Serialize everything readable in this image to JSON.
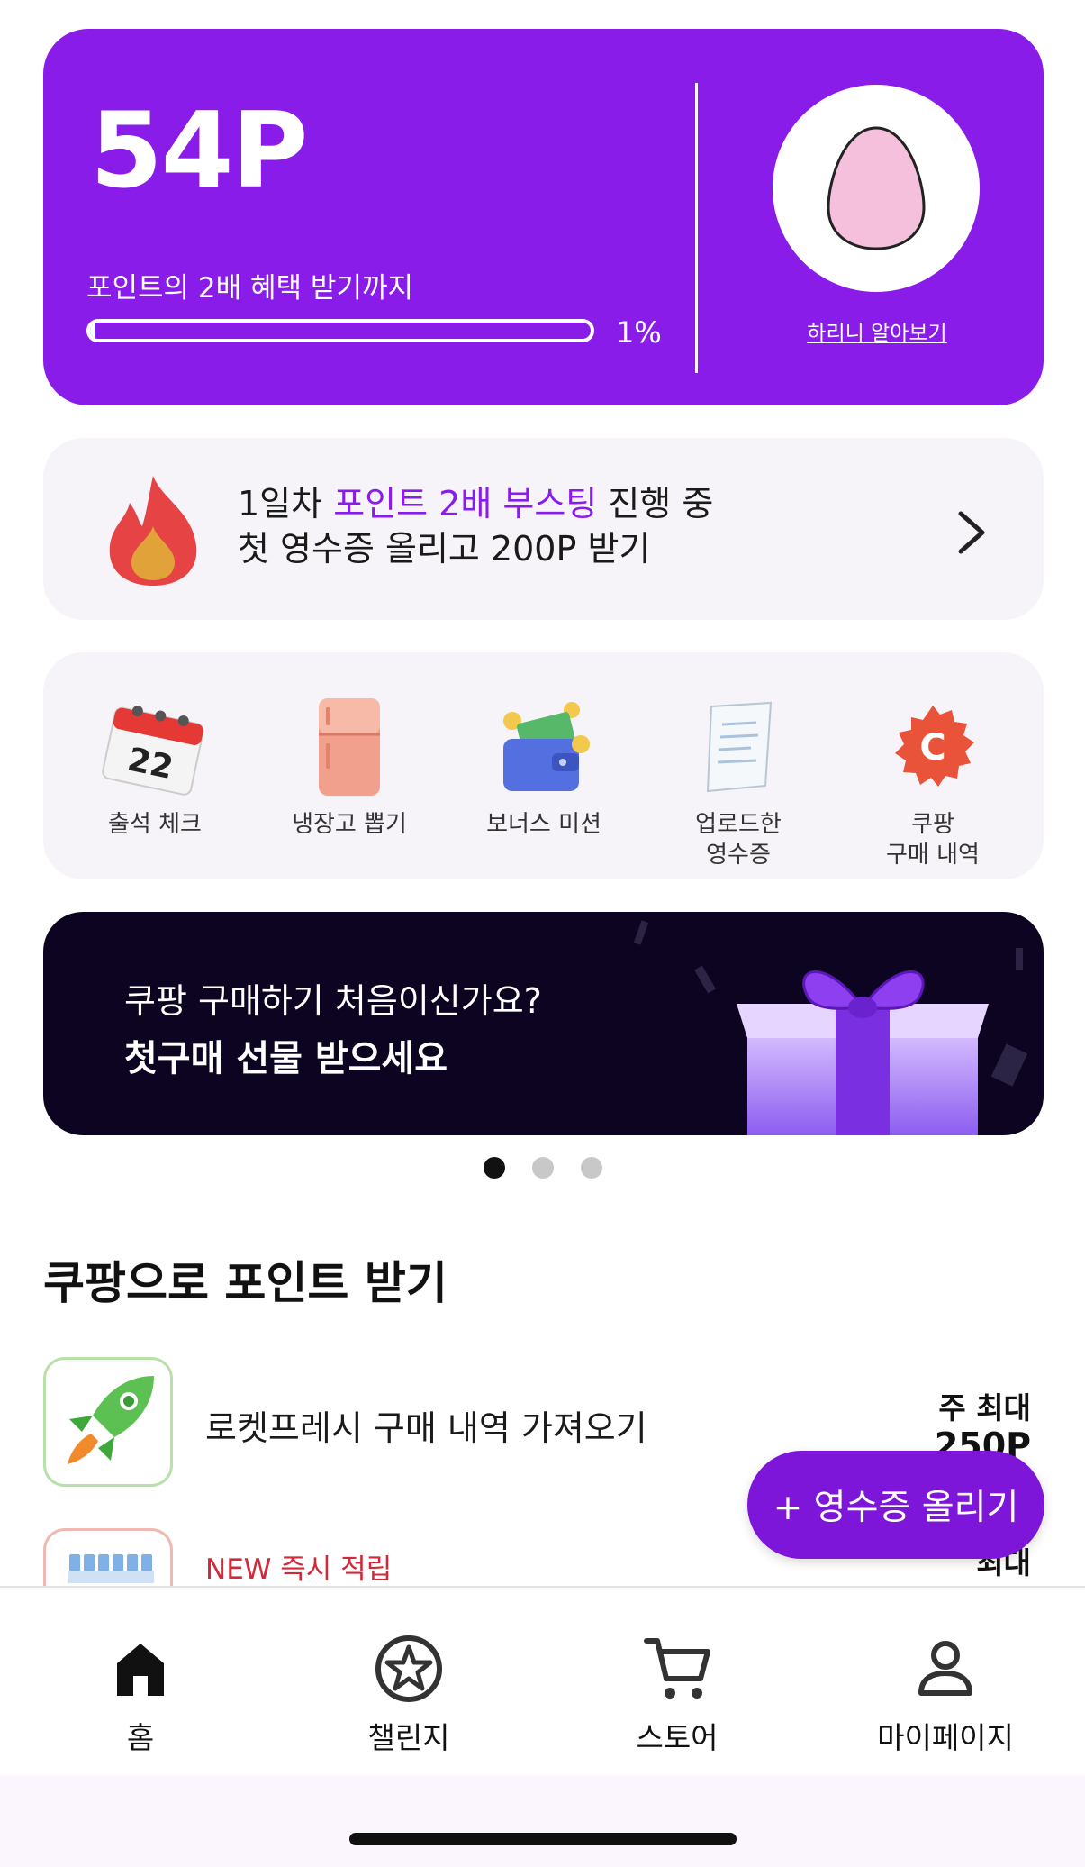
{
  "points_card": {
    "points": "54P",
    "caption": "포인트의 2배 혜택 받기까지",
    "progress_fraction": 0.01,
    "progress_label": "1%",
    "egg_link": "하리니 알아보기",
    "bg_color": "#8a1cea"
  },
  "boost": {
    "line1_prefix": "1일차 ",
    "line1_highlight": "포인트 2배 부스팅",
    "line1_suffix": " 진행 중",
    "line2": "첫 영수증 올리고 200P 받기",
    "icon": "flame-icon",
    "arrow": "chevron-right-icon"
  },
  "quick_menu": [
    {
      "label": "출석 체크",
      "icon": "calendar-icon"
    },
    {
      "label": "냉장고 뽑기",
      "icon": "fridge-icon"
    },
    {
      "label": "보너스 미션",
      "icon": "wallet-icon"
    },
    {
      "label": "업로드한\n영수증",
      "icon": "receipt-icon"
    },
    {
      "label": "쿠팡\n구매 내역",
      "icon": "coupang-icon"
    }
  ],
  "promo": {
    "line1": "쿠팡 구매하기 처음이신가요?",
    "line2": "첫구매 선물 받으세요",
    "icon": "gift-icon"
  },
  "carousel": {
    "count": 3,
    "active_index": 0
  },
  "section": {
    "title": "쿠팡으로 포인트 받기"
  },
  "items": [
    {
      "title": "로켓프레시 구매 내역 가져오기",
      "reward_prefix": "주 최대",
      "reward": "250P",
      "icon": "rocket-icon"
    },
    {
      "tag": "NEW 즉시 적립",
      "reward_prefix": "최대",
      "icon": "product-icon"
    }
  ],
  "fab": {
    "label": "+ 영수증 올리기",
    "color": "#7d16d8"
  },
  "bottom_nav": [
    {
      "label": "홈",
      "icon": "home-icon"
    },
    {
      "label": "챌린지",
      "icon": "star-circle-icon"
    },
    {
      "label": "스토어",
      "icon": "cart-icon"
    },
    {
      "label": "마이페이지",
      "icon": "person-icon"
    }
  ]
}
